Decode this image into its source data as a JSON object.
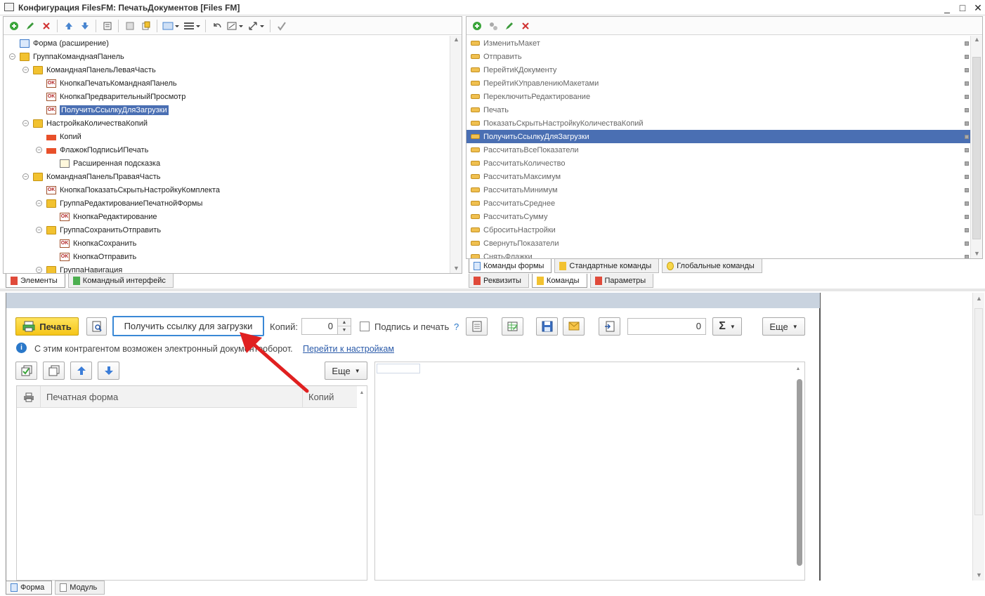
{
  "window": {
    "title": "Конфигурация FilesFM: ПечатьДокументов [Files FM]",
    "minimize": "_",
    "maximize": "□",
    "close": "✕"
  },
  "left_tree": {
    "items": [
      {
        "label": "Форма (расширение)",
        "icon": "form-icon",
        "level": 0,
        "exp": ""
      },
      {
        "label": "ГруппаКоманднаяПанель",
        "icon": "folder-icon",
        "level": 0,
        "exp": "−"
      },
      {
        "label": "КоманднаяПанельЛеваяЧасть",
        "icon": "folder-icon",
        "level": 1,
        "exp": "−"
      },
      {
        "label": "КнопкаПечатьКоманднаяПанель",
        "icon": "ok-button-icon",
        "level": 2,
        "exp": ""
      },
      {
        "label": "КнопкаПредварительныйПросмотр",
        "icon": "ok-button-icon",
        "level": 2,
        "exp": ""
      },
      {
        "label": "ПолучитьСсылкуДляЗагрузки",
        "icon": "ok-button-icon",
        "level": 2,
        "exp": "",
        "selected": true
      },
      {
        "label": "НастройкаКоличестваКопий",
        "icon": "folder-icon",
        "level": 1,
        "exp": "−"
      },
      {
        "label": "Копий",
        "icon": "field-icon",
        "level": 2,
        "exp": ""
      },
      {
        "label": "ФлажокПодписьИПечать",
        "icon": "field-icon",
        "level": 2,
        "exp": "−"
      },
      {
        "label": "Расширенная подсказка",
        "icon": "tooltip-icon",
        "level": 3,
        "exp": ""
      },
      {
        "label": "КоманднаяПанельПраваяЧасть",
        "icon": "folder-icon",
        "level": 1,
        "exp": "−"
      },
      {
        "label": "КнопкаПоказатьСкрытьНастройкуКомплекта",
        "icon": "ok-button-icon",
        "level": 2,
        "exp": ""
      },
      {
        "label": "ГруппаРедактированиеПечатнойФормы",
        "icon": "folder-icon",
        "level": 2,
        "exp": "−"
      },
      {
        "label": "КнопкаРедактирование",
        "icon": "ok-button-icon",
        "level": 3,
        "exp": ""
      },
      {
        "label": "ГруппаСохранитьОтправить",
        "icon": "folder-icon",
        "level": 2,
        "exp": "−"
      },
      {
        "label": "КнопкаСохранить",
        "icon": "ok-button-icon",
        "level": 3,
        "exp": ""
      },
      {
        "label": "КнопкаОтправить",
        "icon": "ok-button-icon",
        "level": 3,
        "exp": ""
      },
      {
        "label": "ГруппаНавигация",
        "icon": "folder-icon",
        "level": 2,
        "exp": "−"
      }
    ],
    "tabs": [
      "Элементы",
      "Командный интерфейс"
    ]
  },
  "commands": {
    "items": [
      "ИзменитьМакет",
      "Отправить",
      "ПерейтиКДокументу",
      "ПерейтиКУправлениюМакетами",
      "ПереключитьРедактирование",
      "Печать",
      "ПоказатьСкрытьНастройкуКоличестваКопий",
      "ПолучитьСсылкуДляЗагрузки",
      "РассчитатьВсеПоказатели",
      "РассчитатьКоличество",
      "РассчитатьМаксимум",
      "РассчитатьМинимум",
      "РассчитатьСреднее",
      "РассчитатьСумму",
      "СброситьНастройки",
      "СвернутьПоказатели",
      "СнятьФлажки"
    ],
    "selected_index": 7,
    "tabs_inner": [
      "Команды формы",
      "Стандартные команды",
      "Глобальные команды"
    ],
    "tabs_outer": [
      "Реквизиты",
      "Команды",
      "Параметры"
    ]
  },
  "preview": {
    "print_button": "Печать",
    "get_link_button": "Получить ссылку для загрузки",
    "copies_label": "Копий:",
    "copies_value": "0",
    "sign_label": "Подпись и печать",
    "help_mark": "?",
    "sum_value": "0",
    "sigma": "Σ",
    "more_label": "Еще",
    "info_text": "С этим контрагентом возможен электронный документооборот.",
    "info_link": "Перейти к настройкам",
    "more_label2": "Еще",
    "col_printform": "Печатная форма",
    "col_copies": "Копий"
  },
  "bottom_tabs": [
    "Форма",
    "Модуль"
  ],
  "colors": {
    "selection": "#4a6fb3",
    "accent_yellow": "#f5c518",
    "arrow_red": "#e02020",
    "header_strip": "#c9d3df"
  }
}
